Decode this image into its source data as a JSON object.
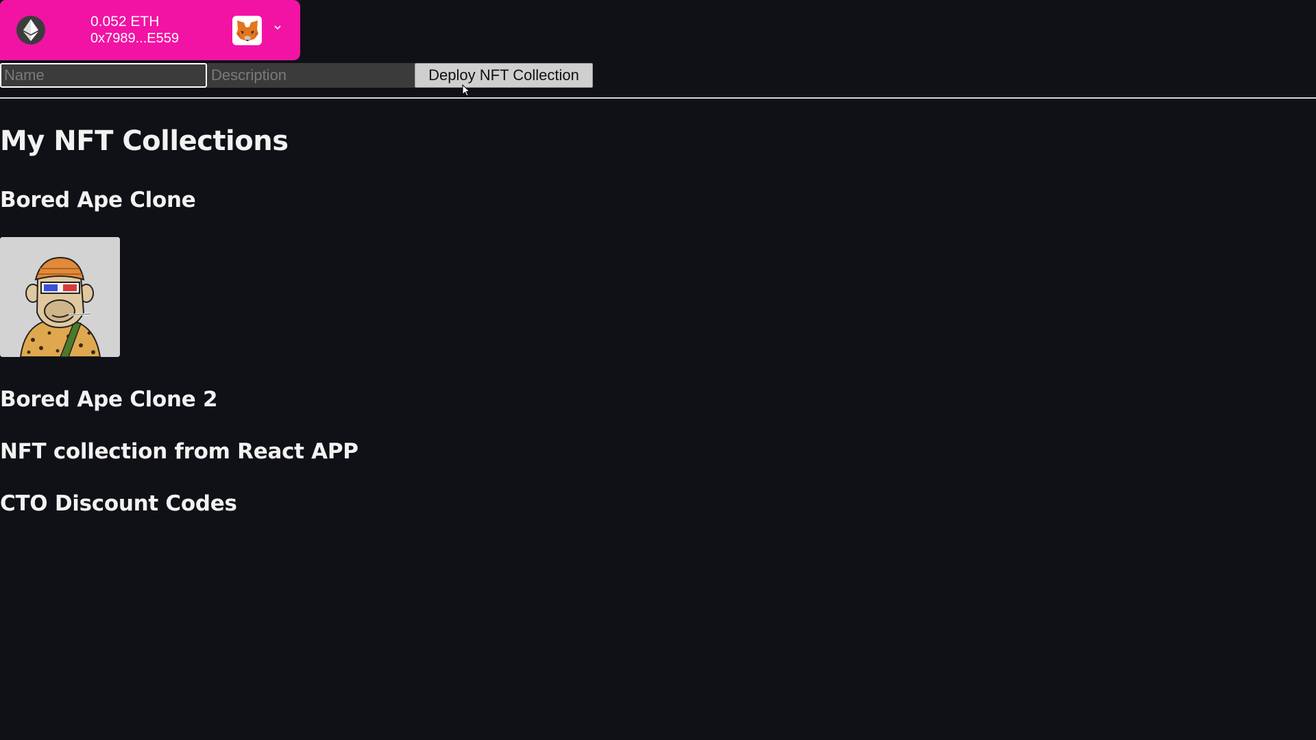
{
  "wallet": {
    "balance": "0.052 ETH",
    "address": "0x7989...E559",
    "network_icon": "ethereum-icon",
    "provider_icon": "metamask-fox-icon",
    "background_color": "#f213a4"
  },
  "deploy_form": {
    "name_placeholder": "Name",
    "name_value": "",
    "description_placeholder": "Description",
    "description_value": "",
    "deploy_label": "Deploy NFT Collection"
  },
  "page_title": "My NFT Collections",
  "collections": [
    {
      "title": "Bored Ape Clone",
      "nfts": [
        {
          "image": "bored-ape-leopard-3d-glasses"
        }
      ]
    },
    {
      "title": "Bored Ape Clone 2",
      "nfts": []
    },
    {
      "title": "NFT collection from React APP",
      "nfts": []
    },
    {
      "title": "CTO Discount Codes",
      "nfts": []
    }
  ]
}
